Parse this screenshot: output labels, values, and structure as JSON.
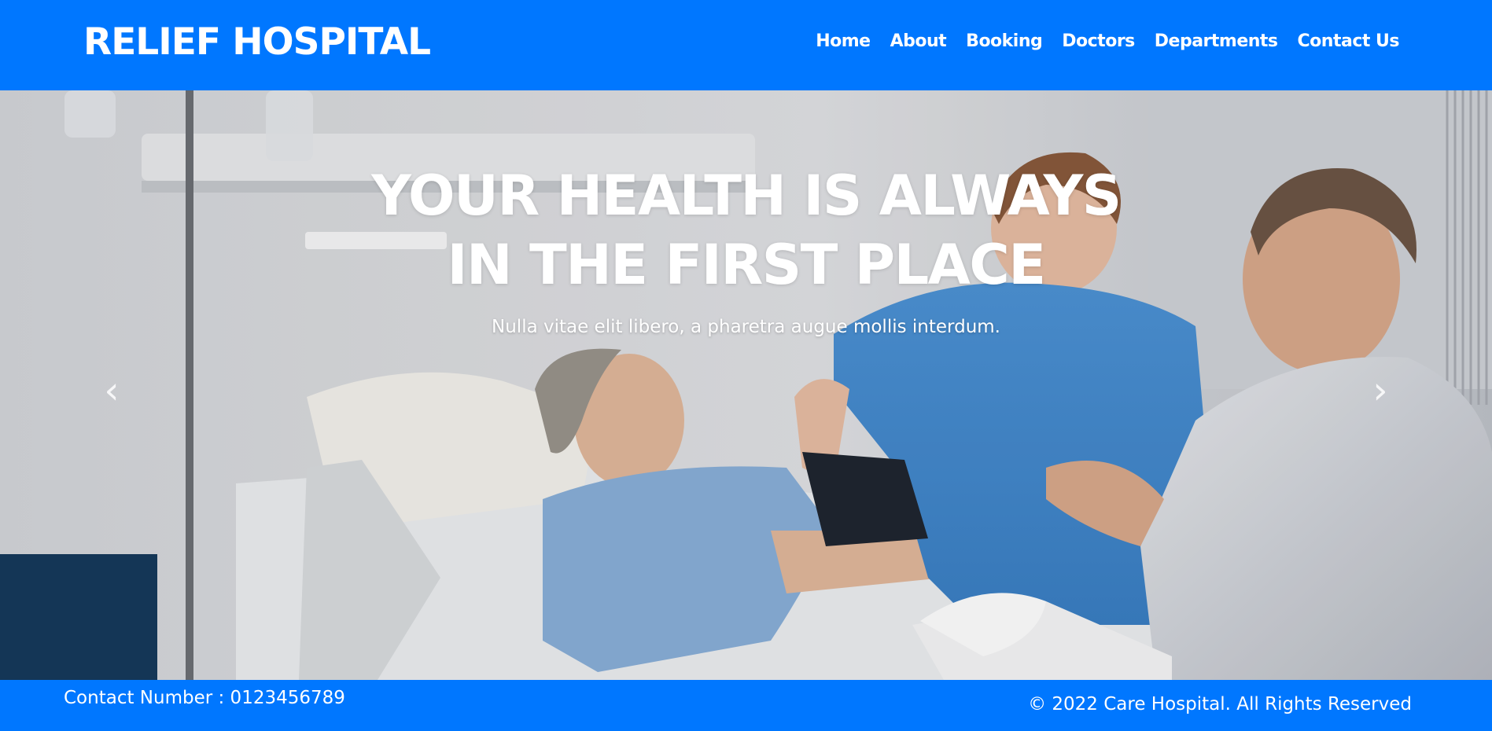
{
  "brand": "RELIEF HOSPITAL",
  "nav": {
    "items": [
      {
        "label": "Home"
      },
      {
        "label": "About"
      },
      {
        "label": "Booking"
      },
      {
        "label": "Doctors"
      },
      {
        "label": "Departments"
      },
      {
        "label": "Contact Us"
      }
    ]
  },
  "hero": {
    "title_line1": "YOUR HEALTH IS ALWAYS",
    "title_line2": "IN THE FIRST PLACE",
    "subtitle": "Nulla vitae elit libero, a pharetra augue mollis interdum.",
    "prev_icon": "chevron-left-icon",
    "next_icon": "chevron-right-icon",
    "prev_glyph": "‹",
    "next_glyph": "›"
  },
  "footer": {
    "contact": "Contact Number : 0123456789",
    "copyright": "© 2022 Care Hospital. All Rights Reserved"
  },
  "colors": {
    "brand_blue": "#0077ff",
    "text_white": "#ffffff"
  }
}
